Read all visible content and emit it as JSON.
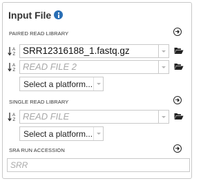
{
  "panel": {
    "title": "Input File",
    "info_icon": "info-circle-icon"
  },
  "paired": {
    "section_label": "PAIRED READ LIBRARY",
    "read1_value": "SRR12316188_1.fastq.gz",
    "read2_placeholder": "READ FILE 2",
    "platform_selected": "Select a platform..."
  },
  "single": {
    "section_label": "SINGLE READ LIBRARY",
    "read_placeholder": "READ FILE",
    "platform_selected": "Select a platform..."
  },
  "sra": {
    "section_label": "SRA RUN ACCESSION",
    "placeholder": "SRR"
  },
  "icons": {
    "add": "arrow-circle-right-icon",
    "sort": "sort-alpha-icon",
    "browse": "folder-open-icon",
    "dropdown": "caret-down-icon"
  },
  "colors": {
    "info": "#2a6fb5",
    "border": "#c9c9c9",
    "placeholder": "#a9a9a9"
  }
}
